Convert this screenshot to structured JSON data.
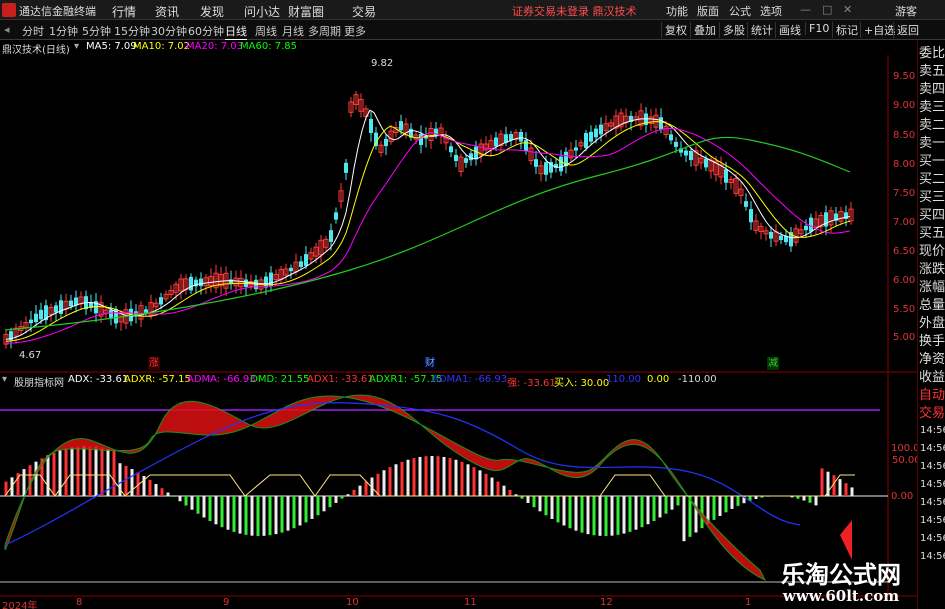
{
  "app": {
    "title": "通达信金融终端"
  },
  "menu": [
    "行情",
    "资讯",
    "发现",
    "问小达",
    "财富圈",
    "交易"
  ],
  "status_warning": "证券交易未登录 鼎汉技术",
  "right_menu": [
    "功能",
    "版面",
    "公式",
    "选项",
    "游客"
  ],
  "periods": [
    "分时",
    "1分钟",
    "5分钟",
    "15分钟",
    "30分钟",
    "60分钟",
    "日线",
    "周线",
    "月线",
    "多周期",
    "更多"
  ],
  "active_period": "日线",
  "tools": [
    "复权",
    "叠加",
    "多股",
    "统计",
    "画线",
    "F10",
    "标记",
    "+自选",
    "返回"
  ],
  "main_indicator": {
    "name": "鼎汉技术(日线)",
    "ma5": "MA5: 7.09",
    "ma10": "MA10: 7.02",
    "ma20": "MA20: 7.03",
    "ma60": "MA60: 7.85",
    "colors": {
      "ma5": "#ffffff",
      "ma10": "#ffff00",
      "ma20": "#ff00ff",
      "ma60": "#00ff00"
    }
  },
  "sub_indicator": {
    "name": "股朋指标网",
    "adx": "ADX: -33.61",
    "adxr": "ADXR: -57.15",
    "adma": "ADMA: -66.93",
    "omd": "OMD: 21.55",
    "adx1": "ADX1: -33.61",
    "adxr1": "ADXR1: -57.15",
    "adma1": "ADMA1: -66.93",
    "strong": "强: -33.61",
    "buy": "买入: 30.00",
    "v1": "110.00",
    "v2": "0.00",
    "v3": "-110.00"
  },
  "price_axis": [
    "9.50",
    "9.00",
    "8.50",
    "8.00",
    "7.50",
    "7.00",
    "6.50",
    "6.00",
    "5.50",
    "5.00"
  ],
  "sub_axis": [
    "100.0",
    "50.00",
    "0.00"
  ],
  "side_panel": [
    "委比",
    "卖五",
    "卖四",
    "卖三",
    "卖二",
    "卖一",
    "买一",
    "买二",
    "买三",
    "买四",
    "买五",
    "现价",
    "涨跌",
    "涨幅",
    "总量",
    "外盘",
    "换手",
    "净资",
    "收益",
    "自动",
    "交易"
  ],
  "side_numbers": [
    "14:56",
    "14:56",
    "14:56",
    "14:56",
    "14:56",
    "14:56",
    "14:56",
    "14:56"
  ],
  "price_high_label": "9.82",
  "price_low_label": "4.67",
  "x_labels": [
    "2024年",
    "8",
    "9",
    "10",
    "11",
    "12",
    "1"
  ],
  "events": [
    "涨",
    "财",
    "减"
  ],
  "watermark": {
    "line1": "乐淘公式网",
    "line2": "www.60lt.com"
  }
}
